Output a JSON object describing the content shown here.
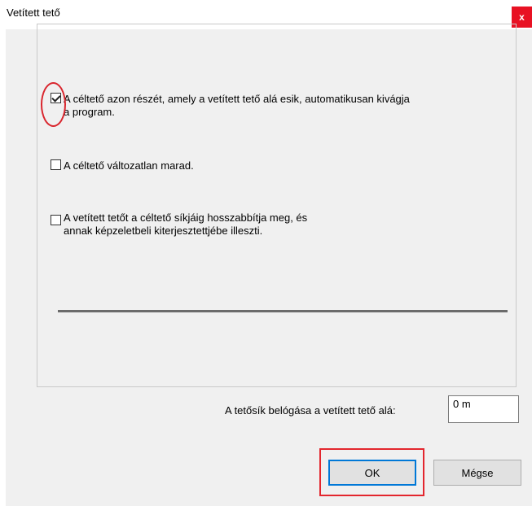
{
  "window": {
    "title": "Vetített tető",
    "close_label": "x"
  },
  "options": [
    {
      "label": "A céltető azon részét, amely a vetített tető alá esik, automatikusan kivágja\na program.",
      "checked": true
    },
    {
      "label": "A céltető változatlan marad.",
      "checked": false
    },
    {
      "label": "A vetített tetőt a céltető síkjáig hosszabbítja meg, és\nannak képzeletbeli kiterjesztettjébe illeszti.",
      "checked": false
    }
  ],
  "depth": {
    "label": "A tetősík belógása a vetített tető alá:",
    "value": "0 m"
  },
  "buttons": {
    "ok": "OK",
    "cancel": "Mégse"
  },
  "colors": {
    "annotation": "#e3262e",
    "close": "#e81123",
    "focus": "#0078d7"
  }
}
